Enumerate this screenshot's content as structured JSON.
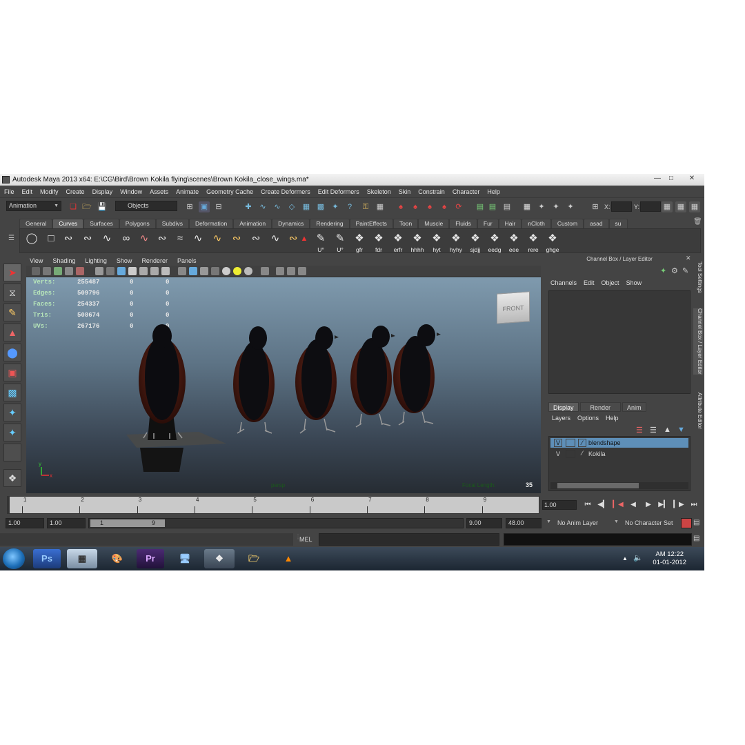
{
  "window": {
    "title": "Autodesk Maya 2013 x64: E:\\CG\\Bird\\Brown Kokila flying\\scenes\\Brown Kokila_close_wings.ma*"
  },
  "menubar": [
    "File",
    "Edit",
    "Modify",
    "Create",
    "Display",
    "Window",
    "Assets",
    "Animate",
    "Geometry Cache",
    "Create Deformers",
    "Edit Deformers",
    "Skeleton",
    "Skin",
    "Constrain",
    "Character",
    "Help"
  ],
  "statusline": {
    "menuset": "Animation",
    "selection_mode": "Objects",
    "x_label": "X:",
    "y_label": "Y:"
  },
  "shelf": {
    "tabs": [
      "General",
      "Curves",
      "Surfaces",
      "Polygons",
      "Subdivs",
      "Deformation",
      "Animation",
      "Dynamics",
      "Rendering",
      "PaintEffects",
      "Toon",
      "Muscle",
      "Fluids",
      "Fur",
      "Hair",
      "nCloth",
      "Custom",
      "asad",
      "su"
    ],
    "active_tab": "Curves",
    "labeled_icons": [
      "U°",
      "U°",
      "gfr",
      "fdr",
      "erfr",
      "hhhh",
      "hyt",
      "hyhy",
      "sjdjj",
      "eedg",
      "eee",
      "rere",
      "ghge"
    ]
  },
  "viewport": {
    "menu": [
      "View",
      "Shading",
      "Lighting",
      "Show",
      "Renderer",
      "Panels"
    ],
    "hud": [
      {
        "label": "Verts:",
        "v1": "255487",
        "v2": "0",
        "v3": "0"
      },
      {
        "label": "Edges:",
        "v1": "509796",
        "v2": "0",
        "v3": "0"
      },
      {
        "label": "Faces:",
        "v1": "254337",
        "v2": "0",
        "v3": "0"
      },
      {
        "label": "Tris:",
        "v1": "508674",
        "v2": "0",
        "v3": "0"
      },
      {
        "label": "UVs:",
        "v1": "267176",
        "v2": "0",
        "v3": "0"
      }
    ],
    "viewcube_label": "FRONT",
    "camera_name": "persp",
    "focal_label": "Focal Length:",
    "focal_value": "35"
  },
  "right_panel": {
    "title": "Channel Box / Layer Editor",
    "channel_menu": [
      "Channels",
      "Edit",
      "Object",
      "Show"
    ],
    "display_tabs": [
      "Display",
      "Render",
      "Anim"
    ],
    "layer_menu": [
      "Layers",
      "Options",
      "Help"
    ],
    "layers": [
      {
        "visible": "V",
        "name": "blendshape",
        "selected": true
      },
      {
        "visible": "V",
        "name": "Kokila",
        "selected": false
      }
    ],
    "side_tabs": [
      "Tool Settings",
      "Channel Box / Layer Editor",
      "Attribute Editor"
    ]
  },
  "timeslider": {
    "ticks": [
      "1",
      "2",
      "3",
      "4",
      "5",
      "6",
      "7",
      "8",
      "9"
    ],
    "current_frame": "1.00"
  },
  "range": {
    "start": "1.00",
    "playback_start": "1.00",
    "slider_start": "1",
    "slider_end": "9",
    "playback_end": "9.00",
    "end": "48.00",
    "anim_layer": "No Anim Layer",
    "character_set": "No Character Set"
  },
  "command_line": {
    "language": "MEL"
  },
  "taskbar": {
    "time": "AM 12:22",
    "date": "01-01-2012",
    "apps": [
      "Ps",
      "Calculator",
      "Paint",
      "Pr",
      "Network",
      "Maya",
      "Explorer",
      "VLC"
    ]
  },
  "colors": {
    "ui_bg": "#444444",
    "selected_layer": "#5e8fb8",
    "hud_label": "#b7e6b9"
  }
}
